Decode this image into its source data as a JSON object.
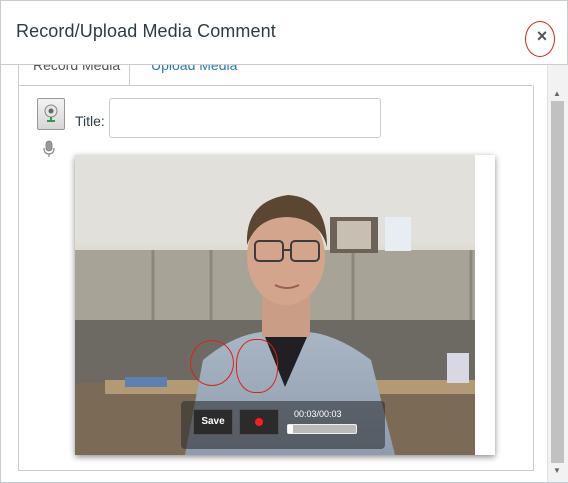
{
  "dialog": {
    "title": "Record/Upload Media Comment",
    "close_glyph": "×"
  },
  "tabs": [
    {
      "label": "Record Media",
      "active": true
    },
    {
      "label": "Upload Media",
      "active": false
    }
  ],
  "form": {
    "title_label": "Title:",
    "title_value": ""
  },
  "recorder": {
    "save_label": "Save",
    "time": "00:03/00:03",
    "progress_fraction": 0.08
  },
  "icons": {
    "camera": "webcam-icon",
    "mic": "microphone-icon",
    "record": "record-icon"
  },
  "colors": {
    "link": "#2a7ab0",
    "record": "#ff1b1b",
    "annotation": "#dd2211"
  }
}
